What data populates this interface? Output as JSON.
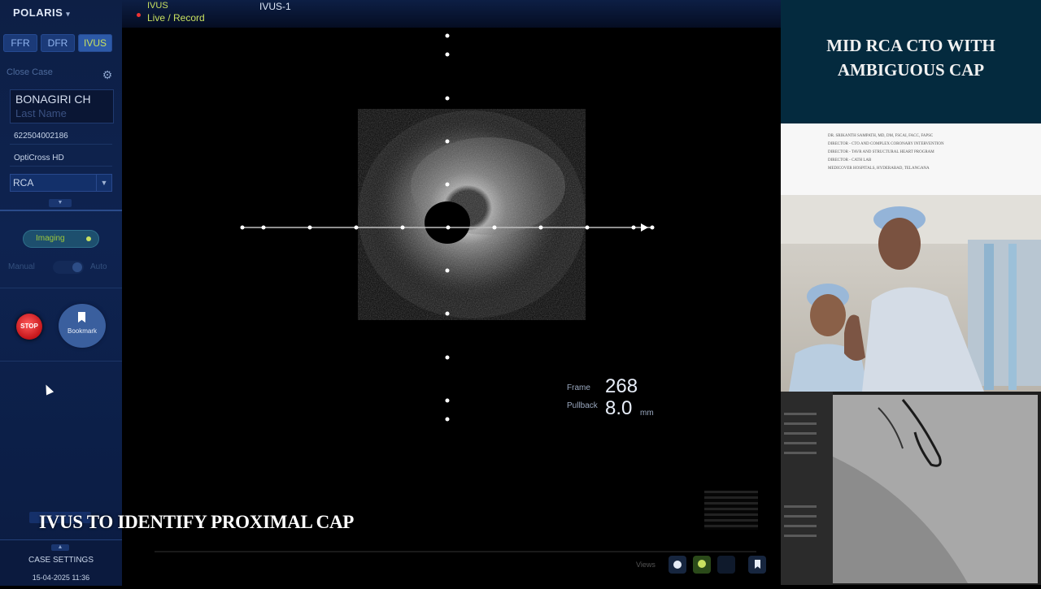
{
  "app": {
    "brand": "POLARIS"
  },
  "modes": [
    "FFR",
    "DFR",
    "IVUS"
  ],
  "sidebar": {
    "close_case": "Close Case",
    "patient_first": "BONAGIRI CH",
    "patient_last": "Last Name",
    "patient_id": "622504002186",
    "catheter": "OptiCross HD",
    "vessel": "RCA",
    "imaging_label": "Imaging",
    "toggle_left": "Manual",
    "toggle_right": "Auto",
    "stop_label": "STOP",
    "bookmark_label": "Bookmark",
    "case_settings": "CASE SETTINGS",
    "datetime": "15-04-2025 11:36"
  },
  "header": {
    "mode": "IVUS",
    "status": "Live / Record",
    "view": "IVUS-1"
  },
  "readout": {
    "frame_label": "Frame",
    "frame_value": "268",
    "pullback_label": "Pullback",
    "pullback_value": "8.0",
    "pullback_unit": "mm"
  },
  "caption": "IVUS  TO IDENTIFY PROXIMAL CAP",
  "bottom_tools": {
    "views_label": "Views"
  },
  "slide": {
    "title_line1": "MID RCA CTO WITH",
    "title_line2": "AMBIGUOUS CAP",
    "credits": [
      "DR. SRIKANTH SAMPATH, MD, DM, FSCAI, FACC, FAPSC",
      "DIRECTOR - CTO AND COMPLEX CORONARY INTERVENTION",
      "DIRECTOR - TAVR AND STRUCTURAL HEART PROGRAM",
      "DIRECTOR - CATH LAB",
      "MEDICOVER HOSPITALS, HYDERABAD, TELANGANA"
    ]
  },
  "colors": {
    "sidebar_bg": "#0d1f45",
    "accent_green": "#c8e060",
    "stop_red": "#d81e23",
    "title_bg": "#042a3e"
  },
  "icons": [
    "gear-icon",
    "dropdown-arrow-icon",
    "stop-icon",
    "bookmark-icon",
    "cursor-icon",
    "record-dot-icon"
  ]
}
